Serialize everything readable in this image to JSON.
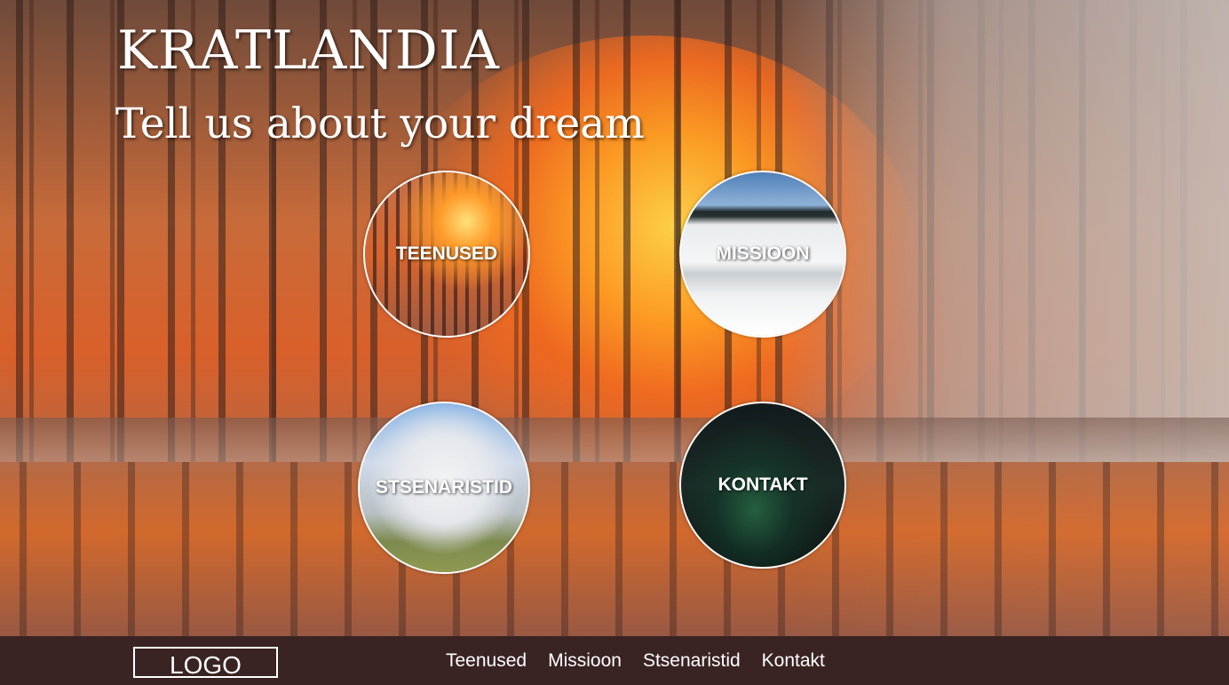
{
  "hero": {
    "title": "KRATLANDIA",
    "tagline": "Tell us about your dream"
  },
  "tiles": [
    {
      "label": "TEENUSED"
    },
    {
      "label": "MISSIOON"
    },
    {
      "label": "STSENARISTID"
    },
    {
      "label": "KONTAKT"
    }
  ],
  "footer": {
    "logo": "LOGO",
    "nav": [
      "Teenused",
      "Missioon",
      "Stsenaristid",
      "Kontakt"
    ]
  },
  "colors": {
    "footer_bg": "#3a2323",
    "text": "#ffffff"
  }
}
